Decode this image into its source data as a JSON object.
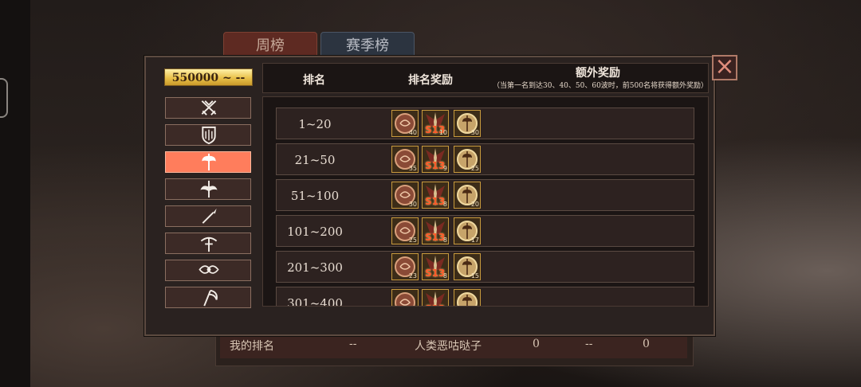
{
  "tabs": {
    "weekly": "周榜",
    "season": "赛季榜"
  },
  "score_badge": "550000 ~ --",
  "header": {
    "rank": "排名",
    "reward": "排名奖励",
    "extra": "额外奖励",
    "extra_note": "（当第一名到达30、40、50、60波时，前500名将获得额外奖励）"
  },
  "sidebar_icons": [
    "crossed-swords-icon",
    "shield-emblem-icon",
    "battle-axe-icon",
    "winged-crest-icon",
    "spear-icon",
    "crossbow-icon",
    "winged-eye-icon",
    "scythe-icon"
  ],
  "active_sidebar_index": 2,
  "reward_rows": [
    {
      "rank": "1~20",
      "items": [
        {
          "type": "coin",
          "count": "40"
        },
        {
          "type": "s13",
          "count": "10",
          "label": "S13"
        },
        {
          "type": "axe-token",
          "count": "30"
        }
      ]
    },
    {
      "rank": "21~50",
      "items": [
        {
          "type": "coin",
          "count": "35"
        },
        {
          "type": "s13",
          "count": "9",
          "label": "S13"
        },
        {
          "type": "axe-token",
          "count": "25"
        }
      ]
    },
    {
      "rank": "51~100",
      "items": [
        {
          "type": "coin",
          "count": "30"
        },
        {
          "type": "s13",
          "count": "8",
          "label": "S13"
        },
        {
          "type": "axe-token",
          "count": "20"
        }
      ]
    },
    {
      "rank": "101~200",
      "items": [
        {
          "type": "coin",
          "count": "25"
        },
        {
          "type": "s13",
          "count": "8",
          "label": "S13"
        },
        {
          "type": "axe-token",
          "count": "17"
        }
      ]
    },
    {
      "rank": "201~300",
      "items": [
        {
          "type": "coin",
          "count": "23"
        },
        {
          "type": "s13",
          "count": "8",
          "label": "S13"
        },
        {
          "type": "axe-token",
          "count": "15"
        }
      ]
    },
    {
      "rank": "301~400",
      "items": [
        {
          "type": "coin",
          "count": ""
        },
        {
          "type": "s13",
          "count": "",
          "label": "S13"
        },
        {
          "type": "axe-token",
          "count": ""
        }
      ]
    }
  ],
  "my_rank_row": {
    "label": "我的排名",
    "rank": "--",
    "name": "人类恶咕哒子",
    "col4": "0",
    "col5": "--",
    "col6": "0"
  },
  "colors": {
    "active_tab": "#ff7d5c",
    "gold": "#e9c14a",
    "close": "#e08d7c"
  }
}
